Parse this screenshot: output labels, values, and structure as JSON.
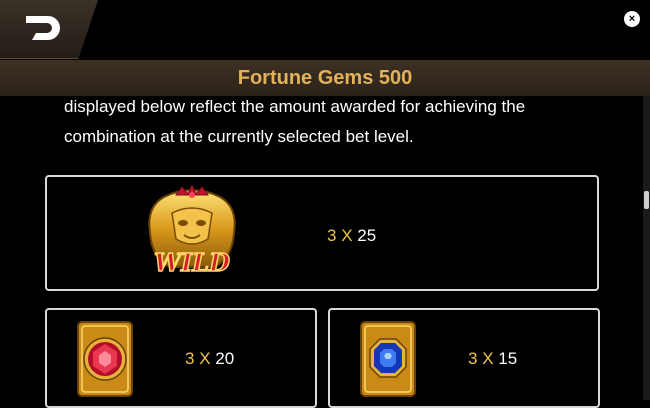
{
  "header": {
    "back_icon": "back-arrow-icon",
    "close_icon": "close-icon",
    "close_label": "×"
  },
  "title": "Fortune Gems 500",
  "description": "displayed below reflect the amount awarded for achieving the combination at the currently selected bet level.",
  "paytable": [
    {
      "symbol": "wild",
      "icon": "wild-mask-icon",
      "label": "WILD",
      "count": "3",
      "x": "X",
      "payout": "25"
    },
    {
      "symbol": "ruby",
      "icon": "ruby-gem-icon",
      "count": "3",
      "x": "X",
      "payout": "20"
    },
    {
      "symbol": "sapphire",
      "icon": "sapphire-gem-icon",
      "count": "3",
      "x": "X",
      "payout": "15"
    }
  ],
  "colors": {
    "title": "#e2b15a",
    "accent": "#f0c24a",
    "panel_border": "#d9d9d9",
    "background": "#000000"
  }
}
